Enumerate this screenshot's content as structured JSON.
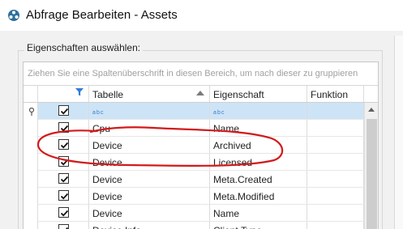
{
  "window": {
    "title": "Abfrage Bearbeiten - Assets"
  },
  "group": {
    "label": "Eigenschaften auswählen:"
  },
  "grid": {
    "group_hint": "Ziehen Sie eine Spaltenüberschrift in diesen Bereich, um nach dieser zu gruppieren",
    "columns": {
      "tabelle": "Tabelle",
      "eigenschaft": "Eigenschaft",
      "funktion": "Funktion"
    },
    "filter_row_icon": "abc-text-filter-icon",
    "rows": [
      {
        "checked": true,
        "tabelle": "Cpu",
        "eigenschaft": "Name",
        "funktion": ""
      },
      {
        "checked": true,
        "tabelle": "Device",
        "eigenschaft": "Archived",
        "funktion": ""
      },
      {
        "checked": true,
        "tabelle": "Device",
        "eigenschaft": "Licensed",
        "funktion": ""
      },
      {
        "checked": true,
        "tabelle": "Device",
        "eigenschaft": "Meta.Created",
        "funktion": ""
      },
      {
        "checked": true,
        "tabelle": "Device",
        "eigenschaft": "Meta.Modified",
        "funktion": ""
      },
      {
        "checked": true,
        "tabelle": "Device",
        "eigenschaft": "Name",
        "funktion": ""
      },
      {
        "checked": true,
        "tabelle": "Device.Info",
        "eigenschaft": "Client.Type",
        "funktion": ""
      }
    ]
  },
  "colors": {
    "filter_row": "#cde4f7",
    "annotation": "#d21a1a",
    "app_icon": "#2f6f9f"
  }
}
